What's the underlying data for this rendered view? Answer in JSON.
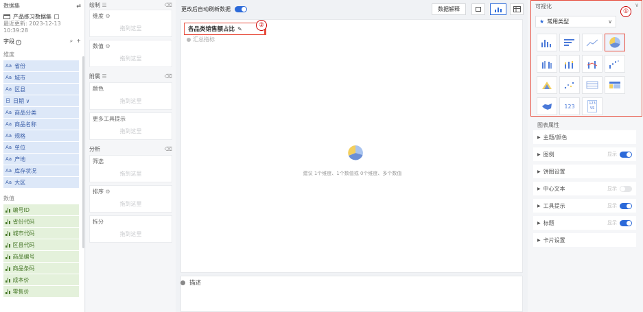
{
  "left": {
    "dataset_header": "数据集",
    "dataset_name": "产品练习数据集",
    "last_update": "最近更新: 2023-12-13 10:39:28",
    "fields_label": "字段",
    "dimension_label": "维度",
    "measure_label": "数值",
    "dimensions": [
      {
        "type": "Aa",
        "name": "省份"
      },
      {
        "type": "Aa",
        "name": "城市"
      },
      {
        "type": "Aa",
        "name": "区县"
      },
      {
        "type": "日",
        "name": "日期 ∨"
      },
      {
        "type": "Aa",
        "name": "商品分类"
      },
      {
        "type": "Aa",
        "name": "商品名称"
      },
      {
        "type": "Aa",
        "name": "规格"
      },
      {
        "type": "Aa",
        "name": "单位"
      },
      {
        "type": "Aa",
        "name": "产地"
      },
      {
        "type": "Aa",
        "name": "库存状况"
      },
      {
        "type": "Aa",
        "name": "大区"
      }
    ],
    "measures": [
      "编号ID",
      "省份代码",
      "城市代码",
      "区县代码",
      "商品编号",
      "商品条码",
      "成本价",
      "零售价"
    ]
  },
  "config": {
    "draw_label": "绘制",
    "dimension_slot": "维度",
    "measure_slot": "数值",
    "drop_hint": "拖到这里",
    "attach_label": "附属",
    "color_slot": "颜色",
    "tooltip_slot": "更多工具提示",
    "analysis_label": "分析",
    "filter_slot": "筛选",
    "sort_slot": "排序",
    "split_slot": "拆分"
  },
  "main": {
    "auto_refresh": "更改后自动刷新数据",
    "explain_button": "数据解释",
    "chart_title": "各品类销售额占比",
    "summary_label": "汇总指标",
    "hint": "建议 1个维度、1个数值或 0个维度、多个数值",
    "desc_label": "描述"
  },
  "right": {
    "viz_label": "可视化",
    "type_select": "常用类型",
    "props_label": "图表属性",
    "props": [
      {
        "label": "主题/颜色"
      },
      {
        "label": "图例",
        "show": "显示",
        "on": true
      },
      {
        "label": "饼图设置"
      },
      {
        "label": "中心文本",
        "show": "显示",
        "on": false
      },
      {
        "label": "工具提示",
        "show": "显示",
        "on": true
      },
      {
        "label": "标题",
        "show": "显示",
        "on": true
      },
      {
        "label": "卡片设置"
      }
    ],
    "badge1": "①",
    "badge2": "②",
    "kpi_label": "123",
    "compare_top": "123",
    "compare_bottom": "VS"
  },
  "colors": {
    "accent": "#2c6ad9",
    "highlight": "#e74c3c",
    "pie_yellow": "#f3cf5d",
    "pie_blue": "#6b8fd6",
    "pie_light": "#a9c4ef"
  }
}
